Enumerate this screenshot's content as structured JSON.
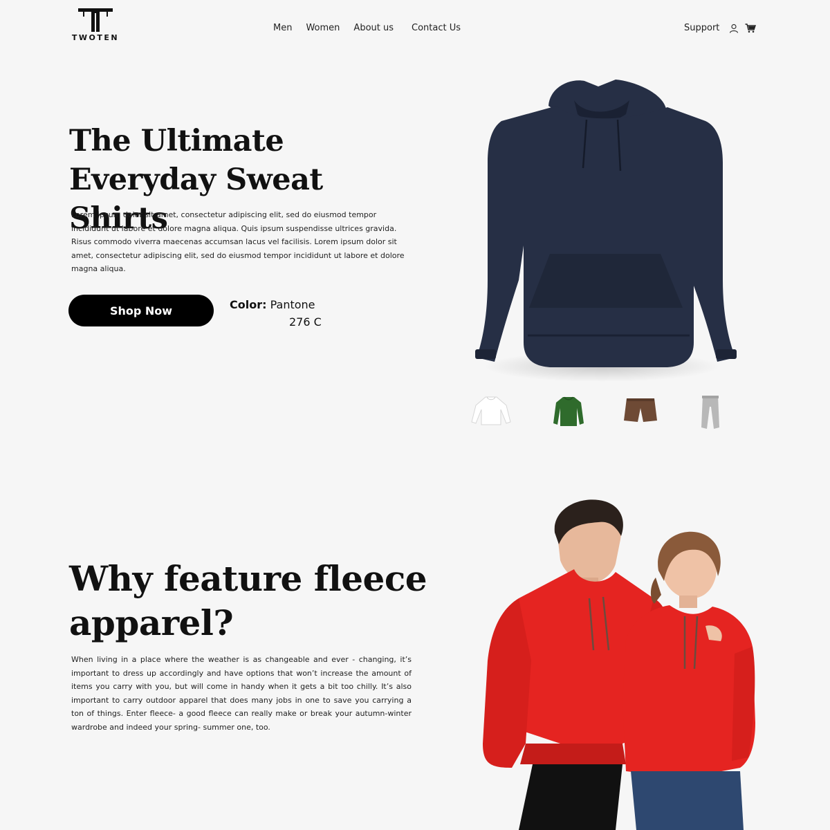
{
  "brand": {
    "name": "TWOTEN"
  },
  "nav": {
    "items": [
      "Men",
      "Women",
      "About us",
      "Contact Us"
    ]
  },
  "header": {
    "support_label": "Support",
    "user_icon": "user-icon",
    "cart_icon": "cart-icon"
  },
  "hero": {
    "title_line1": "The Ultimate",
    "title_line2": "Everyday Sweat Shirts",
    "description": "Lorem ipsum dolor sit amet, consectetur adipiscing elit, sed do eiusmod tempor incididunt ut labore et dolore magna aliqua. Quis ipsum suspendisse ultrices gravida. Risus commodo viverra maecenas accumsan lacus vel facilisis.  Lorem ipsum dolor sit amet, consectetur adipiscing elit, sed do eiusmod tempor incididunt ut labore et dolore magna aliqua.",
    "cta_label": "Shop Now",
    "color_label": "Color:",
    "color_name": "Pantone",
    "color_code": "276 C",
    "product_color": "#262f45",
    "thumbnails": [
      {
        "name": "white-long-sleeve-shirt",
        "color": "#ffffff"
      },
      {
        "name": "green-long-sleeve-shirt",
        "color": "#2f6b2c"
      },
      {
        "name": "brown-shorts",
        "color": "#6e4a35"
      },
      {
        "name": "grey-sweatpants",
        "color": "#b8b8b8"
      }
    ]
  },
  "fleece": {
    "title_line1": "Why feature fleece",
    "title_line2": "apparel?",
    "description": "When living in a place where the weather is as changeable and ever - changing, it’s important to dress up accordingly and have options that won’t increase the amount of items you carry with you, but will come in handy when it gets a bit too chilly. It’s also important to carry outdoor apparel that does many jobs in one to save you carrying a ton of things. Enter fleece- a good fleece can really make or break your autumn-winter wardrobe and indeed your spring- summer one, too.",
    "model_hoodie_color": "#e52421"
  }
}
